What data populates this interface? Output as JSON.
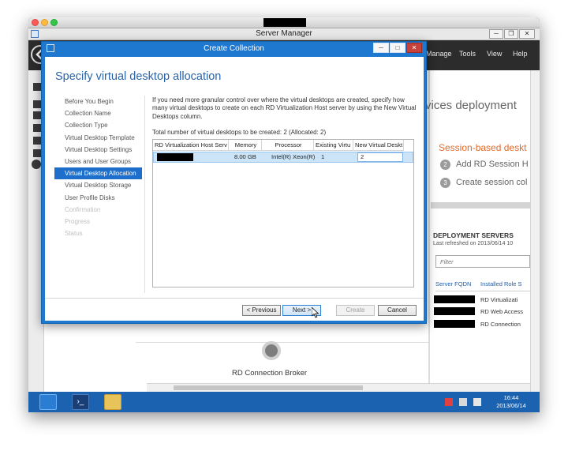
{
  "colors": {
    "dialog_accent": "#1e78d0",
    "heading": "#2b64a8",
    "step_active": "#1e6fcb",
    "taskbar": "#1b63b1",
    "orange_title": "#e06a2b"
  },
  "server_manager": {
    "title": "Server Manager",
    "menu": [
      "Manage",
      "Tools",
      "View",
      "Help"
    ],
    "workspace": {
      "heading_partial": "vices deployment",
      "session_based": "Session-based deskt",
      "steps": [
        {
          "num": "2",
          "label": "Add RD Session H"
        },
        {
          "num": "3",
          "label": "Create session col"
        }
      ],
      "deployment_servers": {
        "title": "DEPLOYMENT SERVERS",
        "last_refreshed": "Last refreshed on 2013/06/14 10",
        "filter_placeholder": "Filter",
        "col_fqdn": "Server FQDN",
        "col_role": "Installed Role S",
        "roles": [
          "RD Virtualizati",
          "RD Web Access",
          "RD Connection"
        ]
      },
      "broker_label": "RD Connection Broker"
    }
  },
  "dialog": {
    "title": "Create Collection",
    "heading": "Specify virtual desktop allocation",
    "steps": [
      {
        "label": "Before You Begin",
        "state": "normal"
      },
      {
        "label": "Collection Name",
        "state": "normal"
      },
      {
        "label": "Collection Type",
        "state": "normal"
      },
      {
        "label": "Virtual Desktop Template",
        "state": "normal"
      },
      {
        "label": "Virtual Desktop Settings",
        "state": "normal"
      },
      {
        "label": "Users and User Groups",
        "state": "normal"
      },
      {
        "label": "Virtual Desktop Allocation",
        "state": "active"
      },
      {
        "label": "Virtual Desktop Storage",
        "state": "normal"
      },
      {
        "label": "User Profile Disks",
        "state": "normal"
      },
      {
        "label": "Confirmation",
        "state": "disabled"
      },
      {
        "label": "Progress",
        "state": "disabled"
      },
      {
        "label": "Status",
        "state": "disabled"
      }
    ],
    "description": "If you need more granular control over where the virtual desktops are created, specify how many virtual desktops to create on each RD Virtualization Host server by using the New Virtual Desktops column.",
    "total_label": "Total number of virtual desktops to be created: 2 (Allocated: 2)",
    "table": {
      "headers": [
        "RD Virtualization Host Serv",
        "Memory",
        "Processor",
        "Existing Virtu",
        "New Virtual Deskt"
      ],
      "row": {
        "memory": "8.00 GB",
        "processor": "Intel(R) Xeon(R) (",
        "existing": "1",
        "new": "2"
      }
    },
    "buttons": {
      "previous": "< Previous",
      "next": "Next >",
      "create": "Create",
      "cancel": "Cancel"
    }
  },
  "taskbar": {
    "time": "16:44",
    "date": "2013/06/14"
  }
}
